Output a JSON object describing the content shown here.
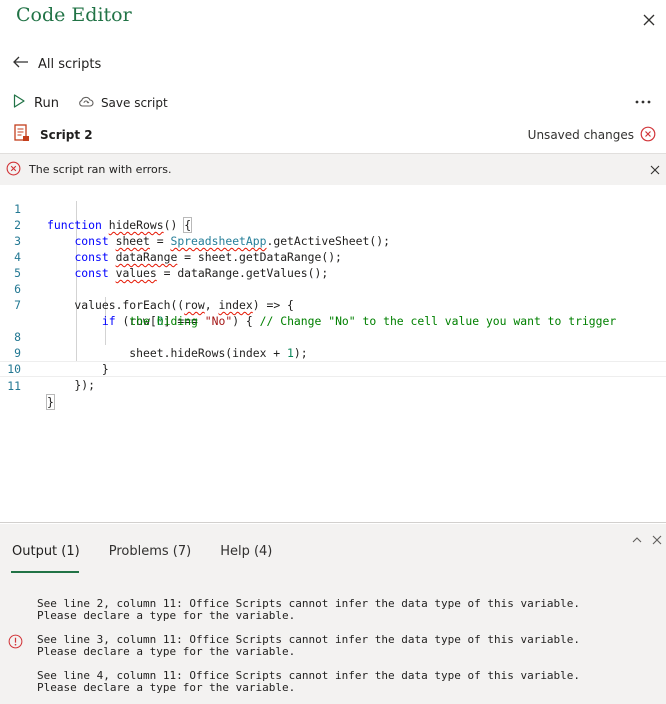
{
  "app": {
    "title": "Code Editor"
  },
  "nav": {
    "back_label": "All scripts"
  },
  "toolbar": {
    "run_label": "Run",
    "save_label": "Save script"
  },
  "script": {
    "name": "Script 2",
    "status": "Unsaved changes"
  },
  "error_bar": {
    "message": "The script ran with errors."
  },
  "code_lines": [
    {
      "n": "1",
      "text": "function hideRows() {"
    },
    {
      "n": "2",
      "text": "    const sheet = SpreadsheetApp.getActiveSheet();"
    },
    {
      "n": "3",
      "text": "    const dataRange = sheet.getDataRange();"
    },
    {
      "n": "4",
      "text": "    const values = dataRange.getValues();"
    },
    {
      "n": "5",
      "text": ""
    },
    {
      "n": "6",
      "text": "    values.forEach((row, index) => {"
    },
    {
      "n": "7",
      "text": "        if (row[0] === \"No\") { // Change \"No\" to the cell value you want to trigger the hiding"
    },
    {
      "n": "8",
      "text": "            sheet.hideRows(index + 1);"
    },
    {
      "n": "9",
      "text": "        }"
    },
    {
      "n": "10",
      "text": "    });"
    },
    {
      "n": "11",
      "text": "}"
    }
  ],
  "panel": {
    "tabs": [
      {
        "label": "Output (1)"
      },
      {
        "label": "Problems (7)"
      },
      {
        "label": "Help (4)"
      }
    ],
    "messages": [
      {
        "line1": "See line 2, column 11: Office Scripts cannot infer the data type of this variable.",
        "line2": "Please declare a type for the variable."
      },
      {
        "line1": "See line 3, column 11: Office Scripts cannot infer the data type of this variable.",
        "line2": "Please declare a type for the variable."
      },
      {
        "line1": "See line 4, column 11: Office Scripts cannot infer the data type of this variable.",
        "line2": "Please declare a type for the variable."
      }
    ]
  },
  "colors": {
    "accent": "#217346",
    "error": "#d13438"
  }
}
